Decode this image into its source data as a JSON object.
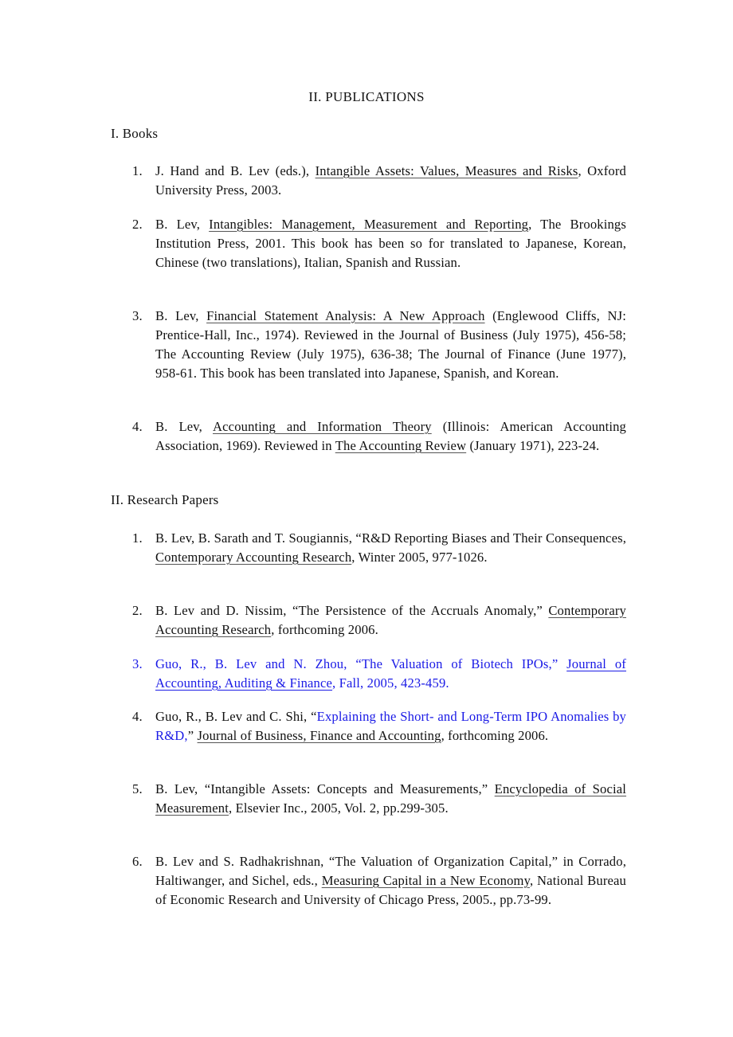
{
  "page": {
    "title": "II. PUBLICATIONS",
    "accent_color": "#1a1ae6"
  },
  "sections": [
    {
      "heading": "I. Books",
      "items": [
        {
          "num": "1.",
          "parts": [
            {
              "text": "J. Hand and B. Lev (eds.), "
            },
            {
              "text": "Intangible Assets: Values, Measures and Risks",
              "underline": true
            },
            {
              "text": ", Oxford University Press, 2003."
            }
          ]
        },
        {
          "num": "2.",
          "parts": [
            {
              "text": "B. Lev, "
            },
            {
              "text": "Intangibles: Management, Measurement and Reporting",
              "underline": true
            },
            {
              "text": ", The Brookings Institution Press, 2001. This book has been so for translated to Japanese, Korean, Chinese (two translations), Italian, Spanish and Russian."
            }
          ]
        },
        {
          "num": "3.",
          "parts": [
            {
              "text": "B. Lev, "
            },
            {
              "text": "Financial Statement Analysis: A New Approach",
              "underline": true
            },
            {
              "text": " (Englewood Cliffs, NJ: Prentice-Hall, Inc., 1974). Reviewed in the Journal of Business (July 1975), 456-58; The Accounting Review (July 1975), 636-38; The Journal of Finance (June 1977), 958-61. This book has been translated into Japanese, Spanish, and Korean."
            }
          ]
        },
        {
          "num": "4.",
          "parts": [
            {
              "text": "B. Lev, "
            },
            {
              "text": "Accounting and Information Theory",
              "underline": true
            },
            {
              "text": " (Illinois: American Accounting Association, 1969). Reviewed in "
            },
            {
              "text": "The Accounting Review",
              "underline": true
            },
            {
              "text": " (January 1971), 223-24."
            }
          ]
        }
      ]
    },
    {
      "heading": "II. Research Papers",
      "items": [
        {
          "num": "1.",
          "parts": [
            {
              "text": "B. Lev, B. Sarath and T. Sougiannis, “R&D Reporting Biases and Their Consequences, "
            },
            {
              "text": "Contemporary Accounting Research",
              "underline": true
            },
            {
              "text": ", Winter 2005, 977-1026."
            }
          ]
        },
        {
          "num": "2.",
          "parts": [
            {
              "text": "B. Lev and D. Nissim, “The Persistence of the Accruals Anomaly,” "
            },
            {
              "text": "Contemporary Accounting Research",
              "underline": true
            },
            {
              "text": ", forthcoming 2006."
            }
          ]
        },
        {
          "num": "3.",
          "blue": true,
          "parts": [
            {
              "text": "Guo, R., B. Lev and N. Zhou, “The Valuation of Biotech IPOs,” "
            },
            {
              "text": "Journal of Accounting, Auditing & Finance",
              "underline": true
            },
            {
              "text": ", Fall, 2005, 423-459."
            }
          ]
        },
        {
          "num": "4.",
          "parts": [
            {
              "text": "Guo, R., B. Lev and C. Shi, “"
            },
            {
              "text": "Explaining the Short- and Long-Term IPO Anomalies by R&D,",
              "blue": true
            },
            {
              "text": "” "
            },
            {
              "text": "Journal of Business, Finance and Accounting",
              "underline": true
            },
            {
              "text": ", forthcoming 2006."
            }
          ]
        },
        {
          "num": "5.",
          "parts": [
            {
              "text": "B. Lev, “Intangible Assets: Concepts and Measurements,” "
            },
            {
              "text": "Encyclopedia of Social Measurement",
              "underline": true
            },
            {
              "text": ", Elsevier Inc., 2005, Vol. 2, pp.299-305."
            }
          ]
        },
        {
          "num": "6.",
          "parts": [
            {
              "text": "B. Lev and S. Radhakrishnan, “The Valuation of Organization Capital,” in Corrado, Haltiwanger, and Sichel, eds., "
            },
            {
              "text": "Measuring Capital in a New Economy",
              "underline": true
            },
            {
              "text": ", National Bureau of Economic Research and University of Chicago Press, 2005., pp.73-99."
            }
          ]
        }
      ]
    }
  ]
}
